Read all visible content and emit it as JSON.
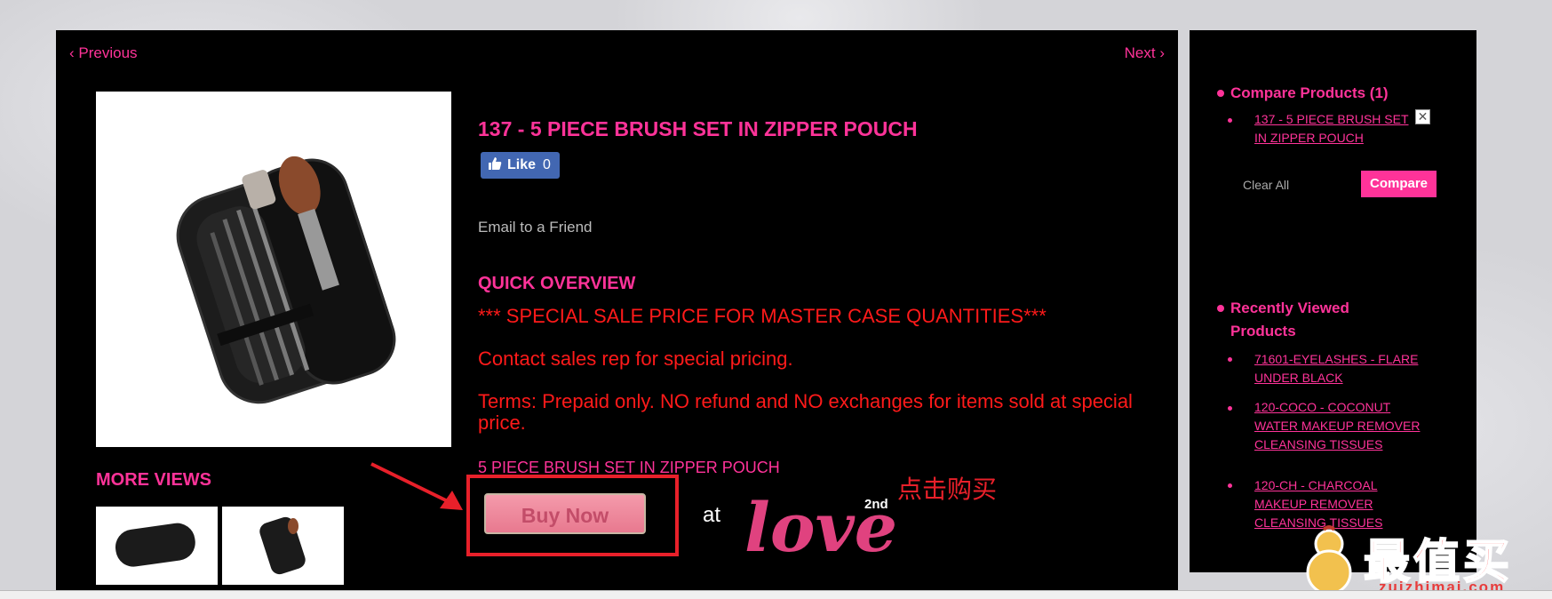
{
  "nav": {
    "previous": "‹ Previous",
    "next": "Next ›"
  },
  "product": {
    "title": "137 - 5 PIECE BRUSH SET IN ZIPPER POUCH",
    "like_label": "Like",
    "like_count": "0",
    "email_friend": "Email to a Friend",
    "quick_overview_title": "QUICK OVERVIEW",
    "overview_lines": [
      "*** SPECIAL SALE PRICE FOR MASTER CASE QUANTITIES***",
      "Contact sales rep for special pricing.",
      "Terms:  Prepaid only.  NO refund and NO exchanges for items sold at special price."
    ],
    "short_description": "5 PIECE BRUSH SET IN ZIPPER POUCH",
    "buy_button": "Buy Now",
    "at_text": "at",
    "store_logo_text": "love",
    "store_logo_sup": "2nd"
  },
  "more_views": {
    "title": "MORE VIEWS"
  },
  "annotation": {
    "chinese_note": "点击购买"
  },
  "sidebar": {
    "compare": {
      "title": "Compare Products (1)",
      "items": [
        "137 - 5 PIECE BRUSH SET IN ZIPPER POUCH"
      ],
      "clear_all": "Clear All",
      "compare_button": "Compare",
      "remove_symbol": "✕"
    },
    "recently_viewed": {
      "title": "Recently Viewed Products",
      "items": [
        "71601-EYELASHES - FLARE UNDER BLACK",
        "120-COCO - COCONUT WATER MAKEUP REMOVER CLEANSING TISSUES",
        "120-CH - CHARCOAL MAKEUP REMOVER CLEANSING TISSUES"
      ]
    }
  },
  "watermark": {
    "text": "最值买",
    "sub": "zuizhimai.com"
  },
  "colors": {
    "accent": "#ff3399",
    "alert_red": "#ff1a1a",
    "background": "#000000"
  }
}
